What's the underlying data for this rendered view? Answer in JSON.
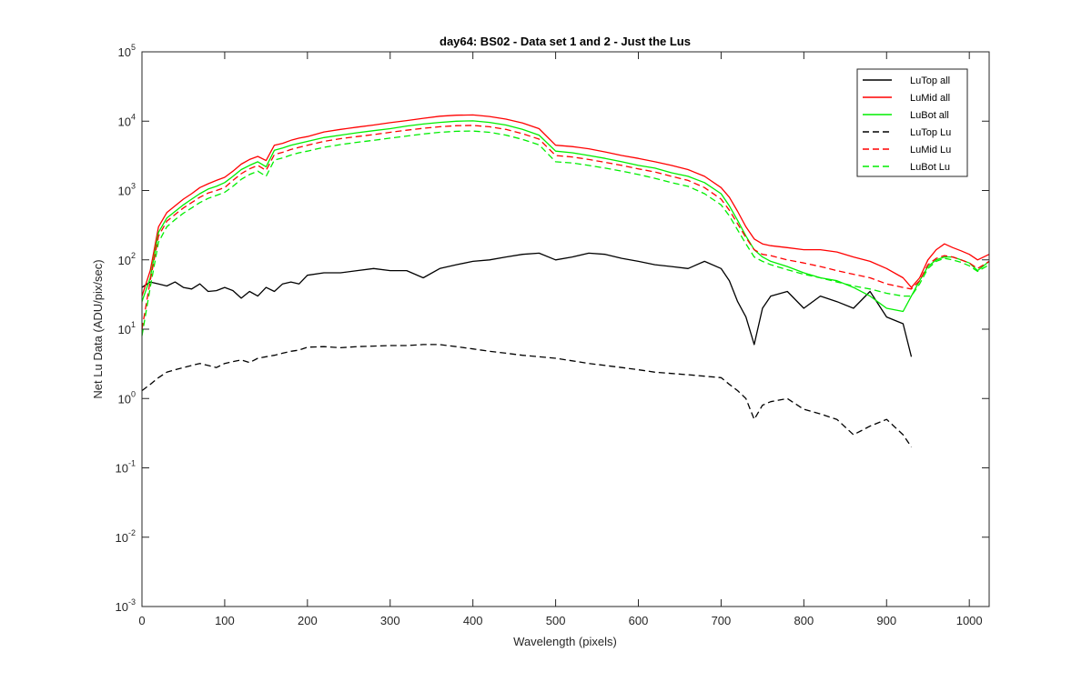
{
  "chart_data": {
    "type": "line",
    "title": "day64: BS02 - Data set 1 and 2 - Just the Lus",
    "xlabel": "Wavelength (pixels)",
    "ylabel": "Net Lu Data (ADU/pix/sec)",
    "xlim": [
      0,
      1024
    ],
    "ylim": [
      0.001,
      100000
    ],
    "yscale": "log",
    "grid": false,
    "legend_position": "top-right",
    "x_ticks": [
      "0",
      "100",
      "200",
      "300",
      "400",
      "500",
      "600",
      "700",
      "800",
      "900",
      "1000"
    ],
    "x_tick_values": [
      0,
      100,
      200,
      300,
      400,
      500,
      600,
      700,
      800,
      900,
      1000
    ],
    "y_ticks": [
      {
        "base": "10",
        "exp": "-3"
      },
      {
        "base": "10",
        "exp": "-2"
      },
      {
        "base": "10",
        "exp": "-1"
      },
      {
        "base": "10",
        "exp": "0"
      },
      {
        "base": "10",
        "exp": "1"
      },
      {
        "base": "10",
        "exp": "2"
      },
      {
        "base": "10",
        "exp": "3"
      },
      {
        "base": "10",
        "exp": "4"
      },
      {
        "base": "10",
        "exp": "5"
      }
    ],
    "y_tick_values": [
      0.001,
      0.01,
      0.1,
      1,
      10,
      100,
      1000,
      10000,
      100000
    ],
    "x": [
      0,
      10,
      20,
      30,
      40,
      50,
      60,
      70,
      80,
      90,
      100,
      110,
      120,
      130,
      140,
      150,
      160,
      170,
      180,
      190,
      200,
      220,
      240,
      260,
      280,
      300,
      320,
      340,
      360,
      380,
      400,
      420,
      440,
      460,
      480,
      500,
      520,
      540,
      560,
      580,
      600,
      620,
      640,
      660,
      680,
      700,
      710,
      720,
      730,
      740,
      750,
      760,
      780,
      800,
      820,
      840,
      860,
      880,
      900,
      920,
      930,
      940,
      950,
      960,
      970,
      980,
      990,
      1000,
      1010,
      1024
    ],
    "series": [
      {
        "name": "LuTop  all",
        "color": "#000000",
        "dash": "solid",
        "values": [
          40,
          48,
          45,
          42,
          48,
          40,
          38,
          45,
          35,
          36,
          40,
          36,
          28,
          35,
          30,
          40,
          35,
          45,
          48,
          45,
          60,
          65,
          65,
          70,
          75,
          70,
          70,
          55,
          75,
          85,
          95,
          100,
          110,
          120,
          125,
          100,
          110,
          125,
          120,
          105,
          95,
          85,
          80,
          75,
          95,
          75,
          50,
          25,
          15,
          6,
          20,
          30,
          35,
          20,
          30,
          25,
          20,
          35,
          15,
          12,
          4,
          null,
          null,
          null,
          null,
          null,
          null,
          null,
          null,
          null
        ]
      },
      {
        "name": "LuMid  all",
        "color": "#ff0000",
        "dash": "solid",
        "values": [
          30,
          70,
          300,
          480,
          600,
          750,
          900,
          1100,
          1250,
          1400,
          1550,
          1900,
          2400,
          2800,
          3100,
          2700,
          4500,
          4800,
          5300,
          5700,
          6000,
          7000,
          7600,
          8200,
          8800,
          9500,
          10200,
          11000,
          11800,
          12200,
          12300,
          11700,
          10700,
          9400,
          7800,
          4500,
          4300,
          4000,
          3600,
          3200,
          2900,
          2600,
          2300,
          2000,
          1600,
          1100,
          800,
          500,
          300,
          200,
          170,
          160,
          150,
          140,
          140,
          130,
          110,
          95,
          75,
          55,
          40,
          55,
          100,
          140,
          170,
          150,
          135,
          120,
          100,
          120
        ]
      },
      {
        "name": "LuBot  all",
        "color": "#00ee00",
        "dash": "solid",
        "values": [
          25,
          55,
          250,
          400,
          500,
          620,
          750,
          900,
          1050,
          1150,
          1300,
          1600,
          2000,
          2300,
          2600,
          2200,
          3800,
          4100,
          4500,
          4800,
          5100,
          5800,
          6300,
          6800,
          7300,
          7800,
          8500,
          9100,
          9600,
          10000,
          10100,
          9600,
          8800,
          7600,
          6300,
          3700,
          3500,
          3200,
          2900,
          2600,
          2300,
          2100,
          1800,
          1600,
          1300,
          900,
          600,
          370,
          220,
          140,
          110,
          95,
          80,
          65,
          55,
          50,
          40,
          30,
          20,
          18,
          30,
          50,
          80,
          100,
          110,
          110,
          100,
          90,
          70,
          95
        ]
      },
      {
        "name": "LuTop  Lu",
        "color": "#000000",
        "dash": "dashed",
        "values": [
          1.3,
          1.6,
          2.0,
          2.4,
          2.6,
          2.8,
          3.0,
          3.2,
          3.0,
          2.8,
          3.2,
          3.4,
          3.6,
          3.3,
          3.8,
          4.0,
          4.2,
          4.5,
          4.8,
          5.0,
          5.5,
          5.6,
          5.4,
          5.6,
          5.7,
          5.8,
          5.8,
          6.0,
          6.0,
          5.6,
          5.2,
          4.8,
          4.5,
          4.2,
          4.0,
          3.8,
          3.5,
          3.2,
          3.0,
          2.8,
          2.6,
          2.4,
          2.3,
          2.2,
          2.1,
          2.0,
          1.6,
          1.3,
          1.0,
          0.5,
          0.8,
          0.9,
          1.0,
          0.7,
          0.6,
          0.5,
          0.3,
          0.4,
          0.5,
          0.3,
          0.2,
          null,
          null,
          null,
          null,
          null,
          null,
          null,
          null,
          null
        ]
      },
      {
        "name": "LuMid  Lu",
        "color": "#ff0000",
        "dash": "dashed",
        "values": [
          10,
          50,
          220,
          360,
          450,
          560,
          670,
          800,
          920,
          1000,
          1100,
          1400,
          1750,
          2050,
          2300,
          1950,
          3300,
          3550,
          3900,
          4200,
          4500,
          5100,
          5600,
          6000,
          6400,
          6900,
          7400,
          7900,
          8300,
          8600,
          8700,
          8300,
          7600,
          6600,
          5500,
          3200,
          3050,
          2800,
          2550,
          2300,
          2050,
          1850,
          1600,
          1400,
          1100,
          750,
          520,
          330,
          210,
          140,
          120,
          115,
          100,
          90,
          80,
          70,
          62,
          55,
          45,
          40,
          38,
          50,
          85,
          105,
          115,
          110,
          100,
          90,
          75,
          95
        ]
      },
      {
        "name": "LuBot  Lu",
        "color": "#00ee00",
        "dash": "dashed",
        "values": [
          8,
          40,
          180,
          300,
          380,
          470,
          560,
          670,
          770,
          850,
          940,
          1150,
          1450,
          1700,
          1900,
          1600,
          2750,
          2950,
          3250,
          3500,
          3700,
          4200,
          4600,
          4950,
          5300,
          5700,
          6100,
          6550,
          6900,
          7150,
          7200,
          6900,
          6300,
          5450,
          4550,
          2600,
          2500,
          2300,
          2100,
          1900,
          1700,
          1500,
          1300,
          1150,
          900,
          620,
          430,
          270,
          170,
          110,
          95,
          85,
          72,
          62,
          55,
          48,
          42,
          38,
          33,
          30,
          30,
          45,
          75,
          95,
          105,
          100,
          92,
          82,
          68,
          85
        ]
      }
    ]
  }
}
